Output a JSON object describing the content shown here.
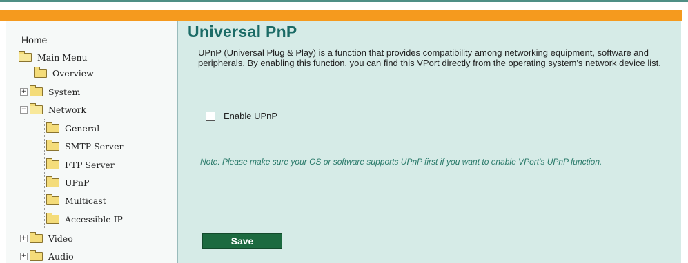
{
  "sidebar": {
    "home": "Home",
    "items": [
      {
        "label": "Main Menu",
        "expander": ""
      },
      {
        "label": "Overview",
        "expander": ""
      },
      {
        "label": "System",
        "expander": "+"
      },
      {
        "label": "Network",
        "expander": "−"
      },
      {
        "label": "General",
        "expander": ""
      },
      {
        "label": "SMTP Server",
        "expander": ""
      },
      {
        "label": "FTP Server",
        "expander": ""
      },
      {
        "label": "UPnP",
        "expander": ""
      },
      {
        "label": "Multicast",
        "expander": ""
      },
      {
        "label": "Accessible IP",
        "expander": ""
      },
      {
        "label": "Video",
        "expander": "+"
      },
      {
        "label": "Audio",
        "expander": "+"
      }
    ]
  },
  "main": {
    "title": "Universal PnP",
    "description": "UPnP (Universal Plug & Play) is a function that provides compatibility among networking equipment, software and peripherals. By enabling this function, you can find this VPort directly from the operating system's network device list.",
    "enable_label": "Enable UPnP",
    "enable_checked": false,
    "note": "Note: Please make sure your OS or software supports UPnP first if you want to enable VPort's UPnP function.",
    "save_label": "Save"
  },
  "colors": {
    "accent_orange": "#f59a1e",
    "title_teal": "#1b6b66",
    "content_bg": "#d6ebe7",
    "save_green": "#1c6a40"
  },
  "icons": {
    "folder": "folder-icon",
    "expander": "tree-expander-icon",
    "checkbox": "checkbox-icon"
  }
}
